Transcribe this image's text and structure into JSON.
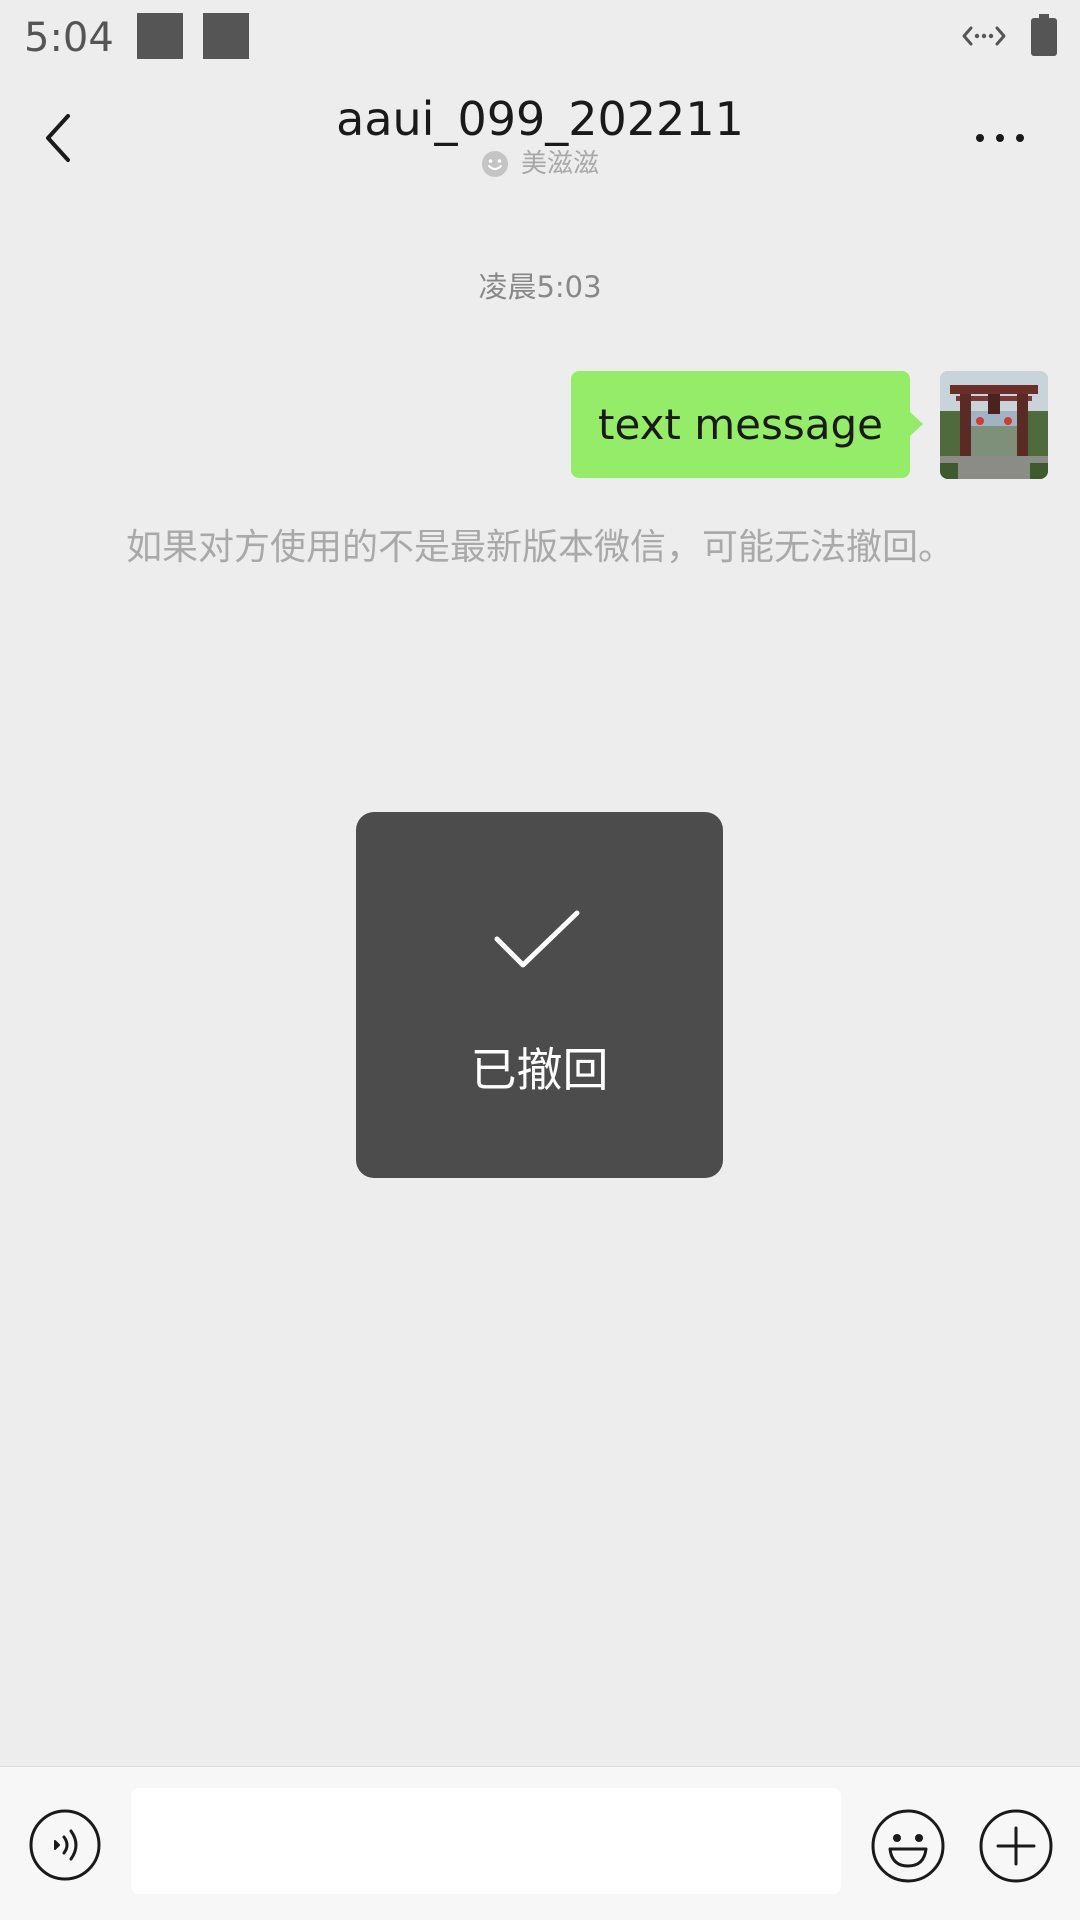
{
  "status_bar": {
    "time": "5:04",
    "icons": [
      "notification-square",
      "notification-square",
      "data-transfer-icon",
      "battery-icon"
    ]
  },
  "header": {
    "title": "aaui_099_202211",
    "subtitle": "美滋滋",
    "subtitle_icon": "face-icon",
    "back_icon": "chevron-left-icon",
    "more_icon": "more-icon"
  },
  "messages": {
    "time": "凌晨5:03",
    "items": [
      {
        "text": "text message",
        "outgoing": true,
        "avatar": "gate-photo-avatar"
      }
    ],
    "recall_notice": "如果对方使用的不是最新版本微信，可能无法撤回。"
  },
  "toast": {
    "icon": "check-icon",
    "text": "已撤回"
  },
  "input_bar": {
    "voice_icon": "voice-icon",
    "input_value": "",
    "emoji_icon": "emoji-icon",
    "plus_icon": "plus-icon"
  },
  "colors": {
    "background": "#ededed",
    "bubble": "#95ec69",
    "toast": "#4c4c4c",
    "input_bar": "#f7f7f7"
  }
}
